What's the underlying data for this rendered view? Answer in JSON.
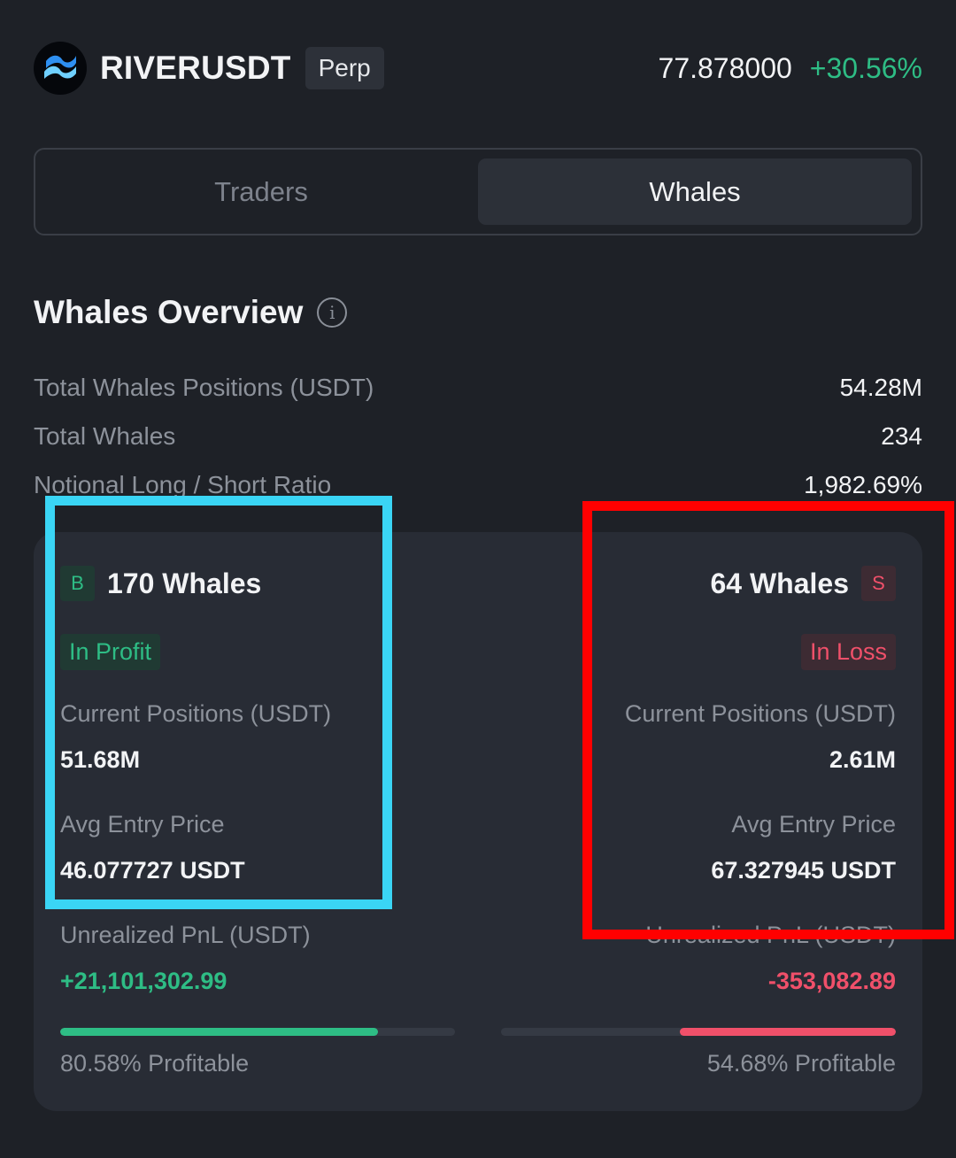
{
  "header": {
    "symbol": "RIVERUSDT",
    "badge": "Perp",
    "price": "77.878000",
    "change": "+30.56%",
    "logo_icon": "river-wave-logo-icon"
  },
  "tabs": [
    {
      "label": "Traders",
      "active": false
    },
    {
      "label": "Whales",
      "active": true
    }
  ],
  "overview": {
    "title": "Whales Overview",
    "info_icon": "i",
    "stats": [
      {
        "label": "Total Whales Positions (USDT)",
        "value": "54.28M"
      },
      {
        "label": "Total Whales",
        "value": "234"
      },
      {
        "label": "Notional Long / Short Ratio",
        "value": "1,982.69%"
      }
    ]
  },
  "long": {
    "badge": "B",
    "count": "170 Whales",
    "status": "In Profit",
    "positions_label": "Current Positions (USDT)",
    "positions_value": "51.68M",
    "avg_entry_label": "Avg Entry Price",
    "avg_entry_value": "46.077727 USDT",
    "pnl_label": "Unrealized PnL (USDT)",
    "pnl_value": "+21,101,302.99",
    "profitable_pct": 80.58,
    "profitable_text": "80.58% Profitable"
  },
  "short": {
    "badge": "S",
    "count": "64 Whales",
    "status": "In Loss",
    "positions_label": "Current Positions (USDT)",
    "positions_value": "2.61M",
    "avg_entry_label": "Avg Entry Price",
    "avg_entry_value": "67.327945 USDT",
    "pnl_label": "Unrealized PnL (USDT)",
    "pnl_value": "-353,082.89",
    "profitable_pct": 54.68,
    "profitable_text": "54.68% Profitable"
  },
  "colors": {
    "background": "#1e2127",
    "card": "#282c35",
    "positive": "#2ebd85",
    "negative": "#f0506a",
    "highlight_long": "#3ad5f5",
    "highlight_short": "#ff0000"
  }
}
